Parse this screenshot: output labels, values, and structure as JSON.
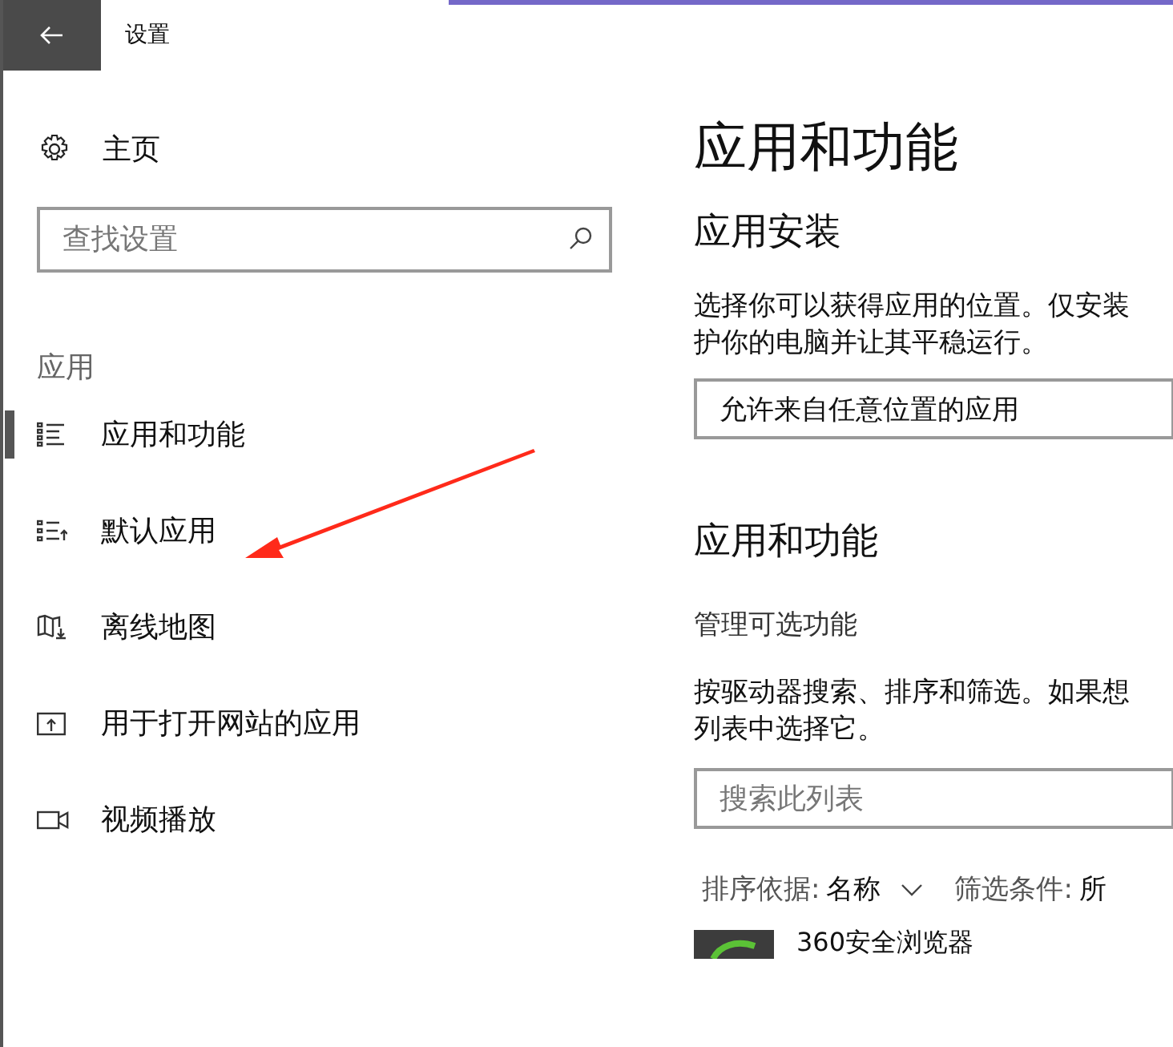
{
  "window": {
    "title": "设置"
  },
  "sidebar": {
    "home": "主页",
    "search": {
      "placeholder": "查找设置"
    },
    "section": "应用",
    "items": [
      {
        "label": "应用和功能",
        "kind": "list",
        "selected": true
      },
      {
        "label": "默认应用",
        "kind": "list-arrow",
        "selected": false
      },
      {
        "label": "离线地图",
        "kind": "map",
        "selected": false
      },
      {
        "label": "用于打开网站的应用",
        "kind": "open-window",
        "selected": false
      },
      {
        "label": "视频播放",
        "kind": "video",
        "selected": false
      }
    ]
  },
  "annotation": {
    "kind": "arrow"
  },
  "main": {
    "title": "应用和功能",
    "install": {
      "heading": "应用安装",
      "description_lines": [
        "选择你可以获得应用的位置。仅安装",
        "护你的电脑并让其平稳运行。"
      ],
      "dropdown": "允许来自任意位置的应用"
    },
    "apps": {
      "heading": "应用和功能",
      "link": "管理可选功能",
      "description_lines": [
        "按驱动器搜索、排序和筛选。如果想",
        "列表中选择它。"
      ],
      "search": {
        "placeholder": "搜索此列表"
      },
      "sort": {
        "label": "排序依据:",
        "value": "名称"
      },
      "filter": {
        "label": "筛选条件:",
        "value": "所"
      },
      "items": [
        {
          "name": "360安全浏览器"
        }
      ]
    }
  }
}
